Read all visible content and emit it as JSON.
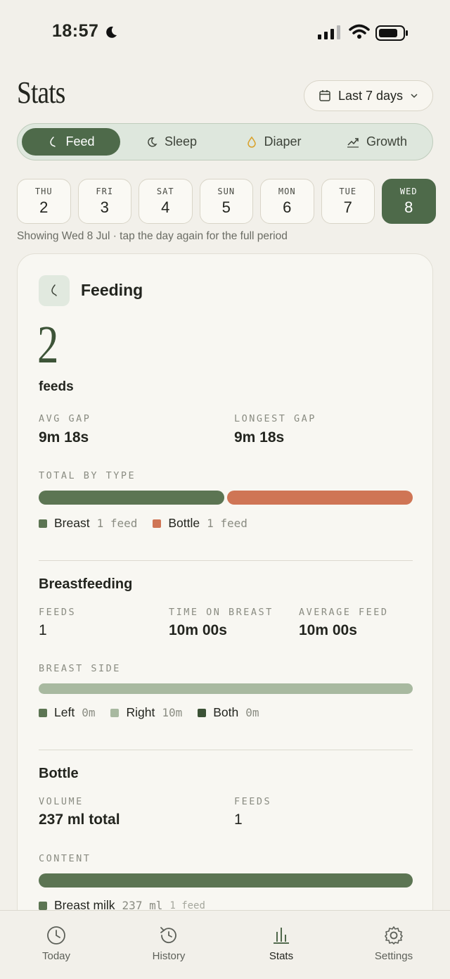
{
  "status": {
    "time": "18:57"
  },
  "header": {
    "title": "Stats",
    "range_label": "Last 7 days"
  },
  "segments": [
    {
      "label": "Feed",
      "icon": "feed-drop-icon",
      "active": true
    },
    {
      "label": "Sleep",
      "icon": "moon-icon",
      "active": false
    },
    {
      "label": "Diaper",
      "icon": "drop-icon",
      "active": false
    },
    {
      "label": "Growth",
      "icon": "trend-icon",
      "active": false
    }
  ],
  "days": [
    {
      "name": "THU",
      "num": "2"
    },
    {
      "name": "FRI",
      "num": "3"
    },
    {
      "name": "SAT",
      "num": "4"
    },
    {
      "name": "SUN",
      "num": "5"
    },
    {
      "name": "MON",
      "num": "6"
    },
    {
      "name": "TUE",
      "num": "7"
    },
    {
      "name": "WED",
      "num": "8",
      "active": true
    }
  ],
  "hint": "Showing Wed 8 Jul · tap the day again for the full period",
  "feeding": {
    "title": "Feeding",
    "count": "2",
    "count_unit": "feeds",
    "avg_gap_label": "AVG GAP",
    "avg_gap": "9m 18s",
    "longest_gap_label": "LONGEST GAP",
    "longest_gap": "9m 18s",
    "total_by_type_label": "TOTAL BY TYPE",
    "type_split": {
      "breast": 0.5,
      "bottle": 0.5
    },
    "legend": [
      {
        "label": "Breast",
        "count": "1 feed",
        "color": "#5C7553"
      },
      {
        "label": "Bottle",
        "count": "1 feed",
        "color": "#CF7555"
      }
    ]
  },
  "breastfeeding": {
    "title": "Breastfeeding",
    "feeds_label": "FEEDS",
    "feeds": "1",
    "time_label": "TIME ON BREAST",
    "time": "10m 00s",
    "avg_label": "AVERAGE FEED",
    "avg": "10m 00s",
    "side_label": "BREAST SIDE",
    "side_split": {
      "left": 0,
      "right": 1,
      "both": 0
    },
    "legend": [
      {
        "label": "Left",
        "count": "0m",
        "color": "#5C7553"
      },
      {
        "label": "Right",
        "count": "10m",
        "color": "#A8B9A0"
      },
      {
        "label": "Both",
        "count": "0m",
        "color": "#3B5236"
      }
    ]
  },
  "bottle": {
    "title": "Bottle",
    "volume_label": "VOLUME",
    "volume": "237 ml total",
    "feeds_label": "FEEDS",
    "feeds": "1",
    "content_label": "CONTENT",
    "content_split": {
      "breast_milk": 1
    },
    "legend": [
      {
        "label": "Breast milk",
        "count": "237 ml",
        "sub": "1 feed",
        "color": "#5C7553"
      }
    ]
  },
  "tabs": [
    {
      "label": "Today",
      "icon": "clock-icon"
    },
    {
      "label": "History",
      "icon": "history-icon"
    },
    {
      "label": "Stats",
      "icon": "bar-chart-icon",
      "active": true
    },
    {
      "label": "Settings",
      "icon": "gear-icon"
    }
  ],
  "colors": {
    "accent": "#4E6A4A",
    "bottle": "#CF7555",
    "background": "#F2F0EA"
  }
}
